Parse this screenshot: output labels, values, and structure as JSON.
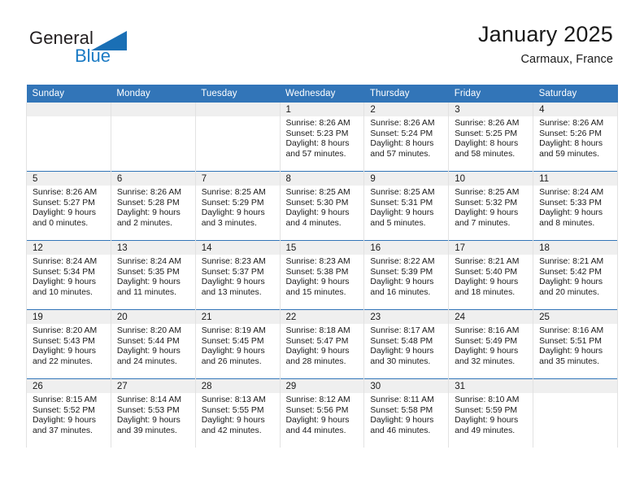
{
  "brand": {
    "name_top": "General",
    "name_bottom": "Blue",
    "triangle_color": "#1a6fb5",
    "text_color": "#231f20",
    "blue_color": "#1a7ac4"
  },
  "header": {
    "title": "January 2025",
    "subtitle": "Carmaux, France"
  },
  "theme": {
    "header_blue": "#3275b8",
    "daynum_band": "#efefef",
    "cell_border": "#e2e2e2"
  },
  "weekdays": [
    "Sunday",
    "Monday",
    "Tuesday",
    "Wednesday",
    "Thursday",
    "Friday",
    "Saturday"
  ],
  "weeks": [
    [
      {
        "empty": true
      },
      {
        "empty": true
      },
      {
        "empty": true
      },
      {
        "day": "1",
        "sunrise": "Sunrise: 8:26 AM",
        "sunset": "Sunset: 5:23 PM",
        "daylight1": "Daylight: 8 hours",
        "daylight2": "and 57 minutes."
      },
      {
        "day": "2",
        "sunrise": "Sunrise: 8:26 AM",
        "sunset": "Sunset: 5:24 PM",
        "daylight1": "Daylight: 8 hours",
        "daylight2": "and 57 minutes."
      },
      {
        "day": "3",
        "sunrise": "Sunrise: 8:26 AM",
        "sunset": "Sunset: 5:25 PM",
        "daylight1": "Daylight: 8 hours",
        "daylight2": "and 58 minutes."
      },
      {
        "day": "4",
        "sunrise": "Sunrise: 8:26 AM",
        "sunset": "Sunset: 5:26 PM",
        "daylight1": "Daylight: 8 hours",
        "daylight2": "and 59 minutes."
      }
    ],
    [
      {
        "day": "5",
        "sunrise": "Sunrise: 8:26 AM",
        "sunset": "Sunset: 5:27 PM",
        "daylight1": "Daylight: 9 hours",
        "daylight2": "and 0 minutes."
      },
      {
        "day": "6",
        "sunrise": "Sunrise: 8:26 AM",
        "sunset": "Sunset: 5:28 PM",
        "daylight1": "Daylight: 9 hours",
        "daylight2": "and 2 minutes."
      },
      {
        "day": "7",
        "sunrise": "Sunrise: 8:25 AM",
        "sunset": "Sunset: 5:29 PM",
        "daylight1": "Daylight: 9 hours",
        "daylight2": "and 3 minutes."
      },
      {
        "day": "8",
        "sunrise": "Sunrise: 8:25 AM",
        "sunset": "Sunset: 5:30 PM",
        "daylight1": "Daylight: 9 hours",
        "daylight2": "and 4 minutes."
      },
      {
        "day": "9",
        "sunrise": "Sunrise: 8:25 AM",
        "sunset": "Sunset: 5:31 PM",
        "daylight1": "Daylight: 9 hours",
        "daylight2": "and 5 minutes."
      },
      {
        "day": "10",
        "sunrise": "Sunrise: 8:25 AM",
        "sunset": "Sunset: 5:32 PM",
        "daylight1": "Daylight: 9 hours",
        "daylight2": "and 7 minutes."
      },
      {
        "day": "11",
        "sunrise": "Sunrise: 8:24 AM",
        "sunset": "Sunset: 5:33 PM",
        "daylight1": "Daylight: 9 hours",
        "daylight2": "and 8 minutes."
      }
    ],
    [
      {
        "day": "12",
        "sunrise": "Sunrise: 8:24 AM",
        "sunset": "Sunset: 5:34 PM",
        "daylight1": "Daylight: 9 hours",
        "daylight2": "and 10 minutes."
      },
      {
        "day": "13",
        "sunrise": "Sunrise: 8:24 AM",
        "sunset": "Sunset: 5:35 PM",
        "daylight1": "Daylight: 9 hours",
        "daylight2": "and 11 minutes."
      },
      {
        "day": "14",
        "sunrise": "Sunrise: 8:23 AM",
        "sunset": "Sunset: 5:37 PM",
        "daylight1": "Daylight: 9 hours",
        "daylight2": "and 13 minutes."
      },
      {
        "day": "15",
        "sunrise": "Sunrise: 8:23 AM",
        "sunset": "Sunset: 5:38 PM",
        "daylight1": "Daylight: 9 hours",
        "daylight2": "and 15 minutes."
      },
      {
        "day": "16",
        "sunrise": "Sunrise: 8:22 AM",
        "sunset": "Sunset: 5:39 PM",
        "daylight1": "Daylight: 9 hours",
        "daylight2": "and 16 minutes."
      },
      {
        "day": "17",
        "sunrise": "Sunrise: 8:21 AM",
        "sunset": "Sunset: 5:40 PM",
        "daylight1": "Daylight: 9 hours",
        "daylight2": "and 18 minutes."
      },
      {
        "day": "18",
        "sunrise": "Sunrise: 8:21 AM",
        "sunset": "Sunset: 5:42 PM",
        "daylight1": "Daylight: 9 hours",
        "daylight2": "and 20 minutes."
      }
    ],
    [
      {
        "day": "19",
        "sunrise": "Sunrise: 8:20 AM",
        "sunset": "Sunset: 5:43 PM",
        "daylight1": "Daylight: 9 hours",
        "daylight2": "and 22 minutes."
      },
      {
        "day": "20",
        "sunrise": "Sunrise: 8:20 AM",
        "sunset": "Sunset: 5:44 PM",
        "daylight1": "Daylight: 9 hours",
        "daylight2": "and 24 minutes."
      },
      {
        "day": "21",
        "sunrise": "Sunrise: 8:19 AM",
        "sunset": "Sunset: 5:45 PM",
        "daylight1": "Daylight: 9 hours",
        "daylight2": "and 26 minutes."
      },
      {
        "day": "22",
        "sunrise": "Sunrise: 8:18 AM",
        "sunset": "Sunset: 5:47 PM",
        "daylight1": "Daylight: 9 hours",
        "daylight2": "and 28 minutes."
      },
      {
        "day": "23",
        "sunrise": "Sunrise: 8:17 AM",
        "sunset": "Sunset: 5:48 PM",
        "daylight1": "Daylight: 9 hours",
        "daylight2": "and 30 minutes."
      },
      {
        "day": "24",
        "sunrise": "Sunrise: 8:16 AM",
        "sunset": "Sunset: 5:49 PM",
        "daylight1": "Daylight: 9 hours",
        "daylight2": "and 32 minutes."
      },
      {
        "day": "25",
        "sunrise": "Sunrise: 8:16 AM",
        "sunset": "Sunset: 5:51 PM",
        "daylight1": "Daylight: 9 hours",
        "daylight2": "and 35 minutes."
      }
    ],
    [
      {
        "day": "26",
        "sunrise": "Sunrise: 8:15 AM",
        "sunset": "Sunset: 5:52 PM",
        "daylight1": "Daylight: 9 hours",
        "daylight2": "and 37 minutes."
      },
      {
        "day": "27",
        "sunrise": "Sunrise: 8:14 AM",
        "sunset": "Sunset: 5:53 PM",
        "daylight1": "Daylight: 9 hours",
        "daylight2": "and 39 minutes."
      },
      {
        "day": "28",
        "sunrise": "Sunrise: 8:13 AM",
        "sunset": "Sunset: 5:55 PM",
        "daylight1": "Daylight: 9 hours",
        "daylight2": "and 42 minutes."
      },
      {
        "day": "29",
        "sunrise": "Sunrise: 8:12 AM",
        "sunset": "Sunset: 5:56 PM",
        "daylight1": "Daylight: 9 hours",
        "daylight2": "and 44 minutes."
      },
      {
        "day": "30",
        "sunrise": "Sunrise: 8:11 AM",
        "sunset": "Sunset: 5:58 PM",
        "daylight1": "Daylight: 9 hours",
        "daylight2": "and 46 minutes."
      },
      {
        "day": "31",
        "sunrise": "Sunrise: 8:10 AM",
        "sunset": "Sunset: 5:59 PM",
        "daylight1": "Daylight: 9 hours",
        "daylight2": "and 49 minutes."
      },
      {
        "empty": true
      }
    ]
  ]
}
